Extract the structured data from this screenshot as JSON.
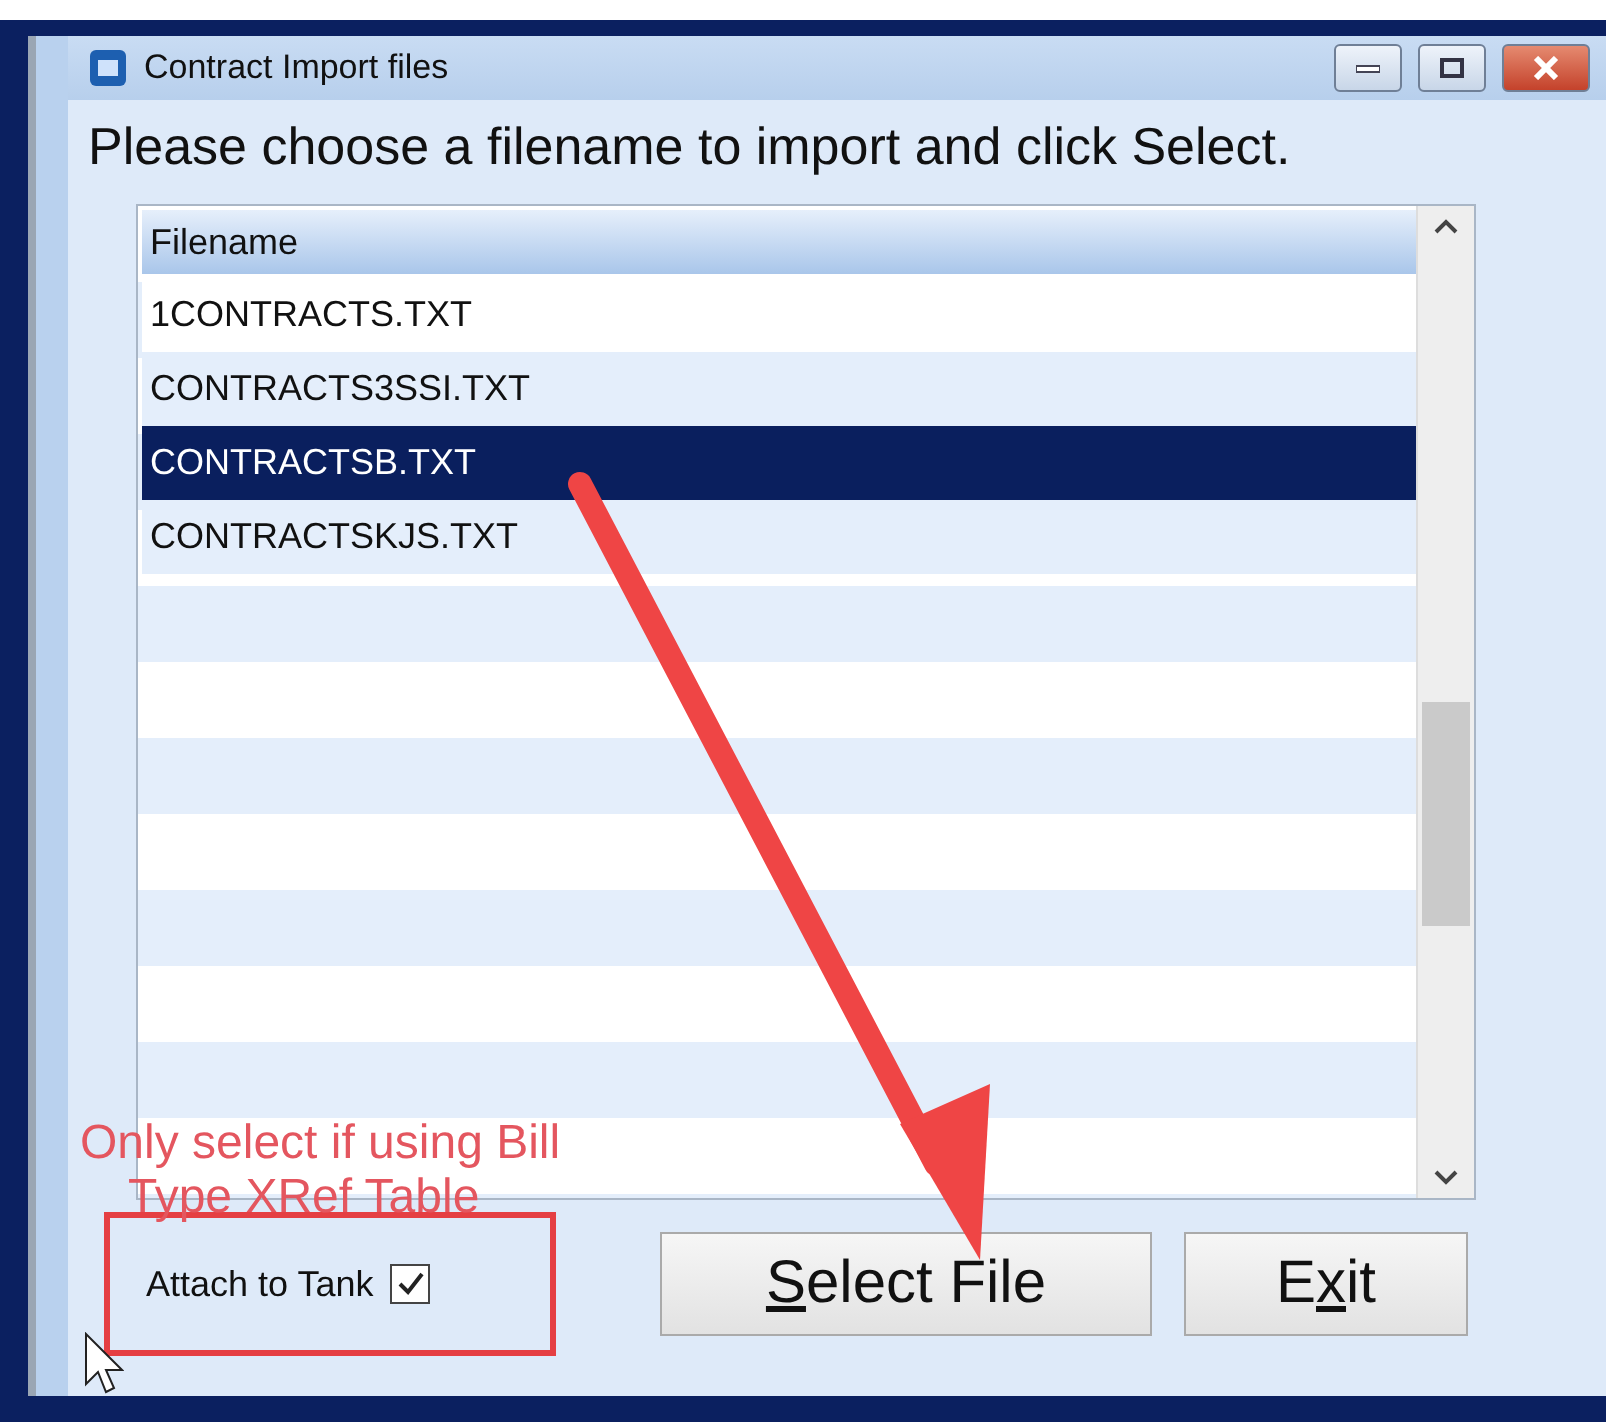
{
  "window": {
    "title": "Contract Import files"
  },
  "heading": "Please choose a filename to import and click Select.",
  "list": {
    "column": "Filename",
    "rows": [
      {
        "filename": "1CONTRACTS.TXT",
        "selected": false
      },
      {
        "filename": "CONTRACTS3SSI.TXT",
        "selected": false
      },
      {
        "filename": "CONTRACTSB.TXT",
        "selected": true
      },
      {
        "filename": "CONTRACTSKJS.TXT",
        "selected": false
      }
    ]
  },
  "note": [
    "Only select if using Bill",
    "Type XRef Table"
  ],
  "checkbox": {
    "label": "Attach to Tank",
    "checked": true
  },
  "buttons": [
    {
      "key": "S",
      "after": "elect File"
    },
    {
      "before": "E",
      "key": "x",
      "after": "it"
    }
  ]
}
